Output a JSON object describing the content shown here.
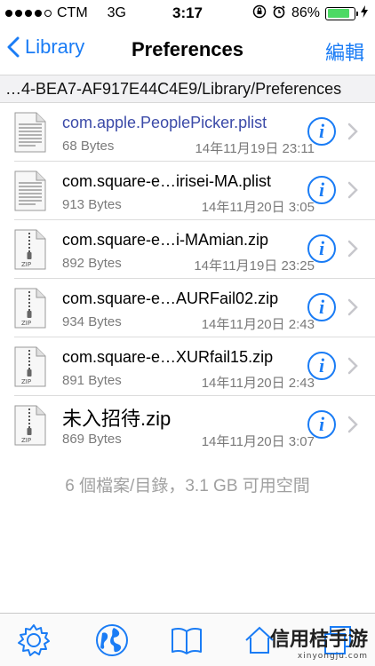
{
  "status_bar": {
    "carrier": "CTM",
    "network": "3G",
    "time": "3:17",
    "battery_percent": "86%",
    "battery_level": 0.86
  },
  "nav": {
    "back_label": "Library",
    "title": "Preferences",
    "edit_label": "編輯"
  },
  "path": "…4-BEA7-AF917E44C4E9/Library/Preferences",
  "files": [
    {
      "name": "com.apple.PeoplePicker.plist",
      "size": "68 Bytes",
      "date": "14年11月19日 23:11",
      "icon": "plist-document-icon"
    },
    {
      "name": "com.square-e…irisei-MA.plist",
      "size": "913 Bytes",
      "date": "14年11月20日 3:05",
      "icon": "plist-document-icon"
    },
    {
      "name": "com.square-e…i-MAmian.zip",
      "size": "892 Bytes",
      "date": "14年11月19日 23:25",
      "icon": "zip-document-icon"
    },
    {
      "name": "com.square-e…AURFail02.zip",
      "size": "934 Bytes",
      "date": "14年11月20日 2:43",
      "icon": "zip-document-icon"
    },
    {
      "name": "com.square-e…XURfail15.zip",
      "size": "891 Bytes",
      "date": "14年11月20日 2:43",
      "icon": "zip-document-icon"
    },
    {
      "name": "未入招待.zip",
      "size": "869 Bytes",
      "date": "14年11月20日 3:07",
      "icon": "zip-document-icon"
    }
  ],
  "info_glyph": "i",
  "footer": "6 個檔案/目錄，3.1 GB 可用空間",
  "watermark": {
    "text": "信用桔手游",
    "sub": "xinyongju.com"
  },
  "colors": {
    "accent": "#1a7cf5",
    "first_file_name": "#3b4aa8",
    "battery": "#4cd964"
  }
}
